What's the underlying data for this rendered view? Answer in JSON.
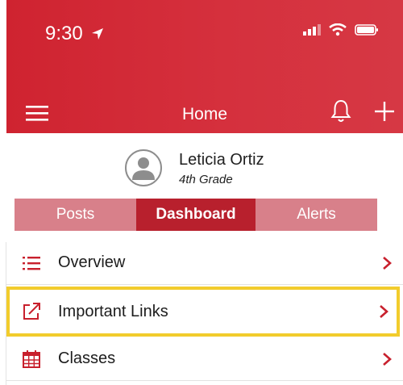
{
  "status_bar": {
    "time": "9:30"
  },
  "header": {
    "title": "Home"
  },
  "profile": {
    "name": "Leticia Ortiz",
    "grade": "4th Grade"
  },
  "tabs": [
    {
      "label": "Posts",
      "active": false
    },
    {
      "label": "Dashboard",
      "active": true
    },
    {
      "label": "Alerts",
      "active": false
    }
  ],
  "menu": [
    {
      "label": "Overview",
      "icon": "list-icon"
    },
    {
      "label": "Important Links",
      "icon": "external-link-icon",
      "highlighted": true
    },
    {
      "label": "Classes",
      "icon": "calendar-icon"
    }
  ],
  "colors": {
    "header": "#d12c38",
    "accent": "#c8202d",
    "highlight_border": "#f2cc2c"
  }
}
